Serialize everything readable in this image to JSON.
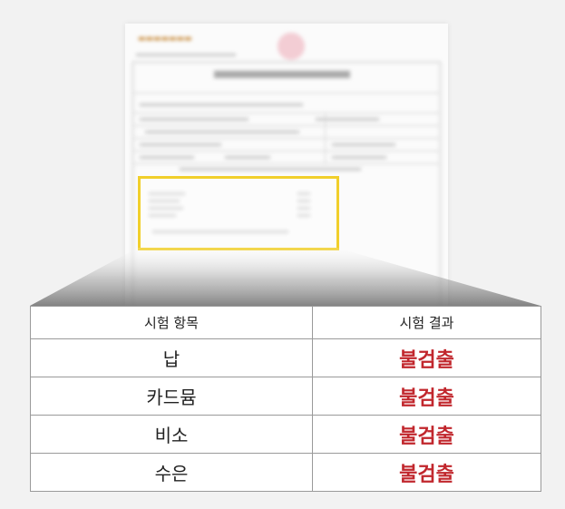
{
  "table": {
    "headers": [
      "시험 항목",
      "시험 결과"
    ],
    "rows": [
      {
        "item": "납",
        "result": "불검출"
      },
      {
        "item": "카드뮴",
        "result": "불검출"
      },
      {
        "item": "비소",
        "result": "불검출"
      },
      {
        "item": "수은",
        "result": "불검출"
      }
    ]
  },
  "colors": {
    "highlight_border": "#f1cf2b",
    "result_text": "#c1272d",
    "background": "#f2f2f2"
  }
}
